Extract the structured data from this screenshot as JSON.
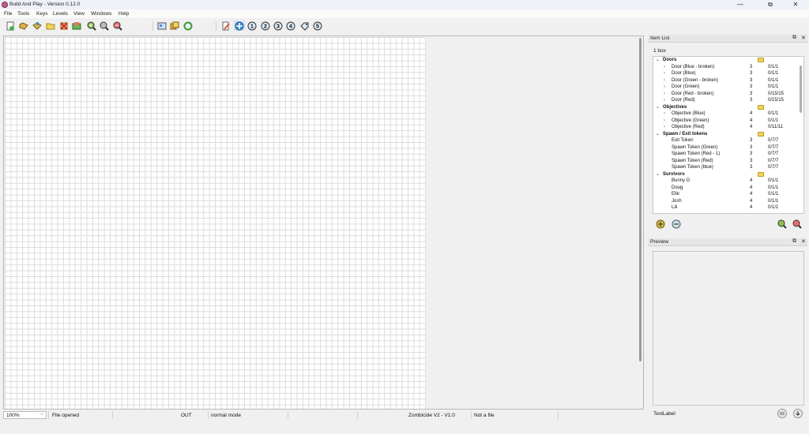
{
  "window": {
    "title": "Build And Play - Version 0.12.0",
    "minimize": "—",
    "maximize": "⧉",
    "close": "✕"
  },
  "menu": [
    "File",
    "Tools",
    "Keys",
    "Levels",
    "View",
    "Windows",
    "Help"
  ],
  "toolbar": {
    "level_numbers": [
      "1",
      "2",
      "3",
      "4",
      "5"
    ]
  },
  "item_list_panel": {
    "title": "Item List",
    "box_count": "1 box",
    "groups": [
      {
        "name": "Doors",
        "items": [
          {
            "name": "Door (Blue - broken)",
            "qty": "3",
            "count": "0/1/1"
          },
          {
            "name": "Door (Blue)",
            "qty": "3",
            "count": "0/1/1"
          },
          {
            "name": "Door (Green - broken)",
            "qty": "3",
            "count": "0/1/1"
          },
          {
            "name": "Door (Green)",
            "qty": "3",
            "count": "0/1/1"
          },
          {
            "name": "Door (Red - broken)",
            "qty": "3",
            "count": "0/15/15"
          },
          {
            "name": "Door (Red)",
            "qty": "3",
            "count": "0/15/15"
          }
        ]
      },
      {
        "name": "Objectives",
        "items": [
          {
            "name": "Objective (Blue)",
            "qty": "4",
            "count": "0/1/1"
          },
          {
            "name": "Objective (Green)",
            "qty": "4",
            "count": "0/1/1"
          },
          {
            "name": "Objective (Red)",
            "qty": "4",
            "count": "0/11/11"
          }
        ]
      },
      {
        "name": "Spawn / Exit tokens",
        "items": [
          {
            "name": "Exit Token",
            "qty": "3",
            "count": "0/7/7"
          },
          {
            "name": "Spawn Token (Green)",
            "qty": "3",
            "count": "0/7/7"
          },
          {
            "name": "Spawn Token (Red - 1)",
            "qty": "3",
            "count": "0/7/7"
          },
          {
            "name": "Spawn Token (Red)",
            "qty": "3",
            "count": "0/7/7"
          },
          {
            "name": "Spawn Token (blue)",
            "qty": "3",
            "count": "0/7/7"
          }
        ]
      },
      {
        "name": "Survivors",
        "items": [
          {
            "name": "Bunny G",
            "qty": "4",
            "count": "0/1/1"
          },
          {
            "name": "Doug",
            "qty": "4",
            "count": "0/1/1"
          },
          {
            "name": "Elle",
            "qty": "4",
            "count": "0/1/1"
          },
          {
            "name": "Josh",
            "qty": "4",
            "count": "0/1/1"
          },
          {
            "name": "Lili",
            "qty": "4",
            "count": "0/1/1"
          }
        ]
      }
    ]
  },
  "preview_panel": {
    "title": "Preview",
    "text_label": "TextLabel"
  },
  "status": {
    "zoom": "100%",
    "message": "File opened",
    "io": "OUT",
    "mode": "normal mode",
    "game": "Zombicide V2 - V1.0",
    "file": "Not a file"
  },
  "colors": {
    "accent_blue": "#4a8fd8",
    "folder_yellow": "#f2d35a",
    "grid_line": "#dcdcdc"
  }
}
